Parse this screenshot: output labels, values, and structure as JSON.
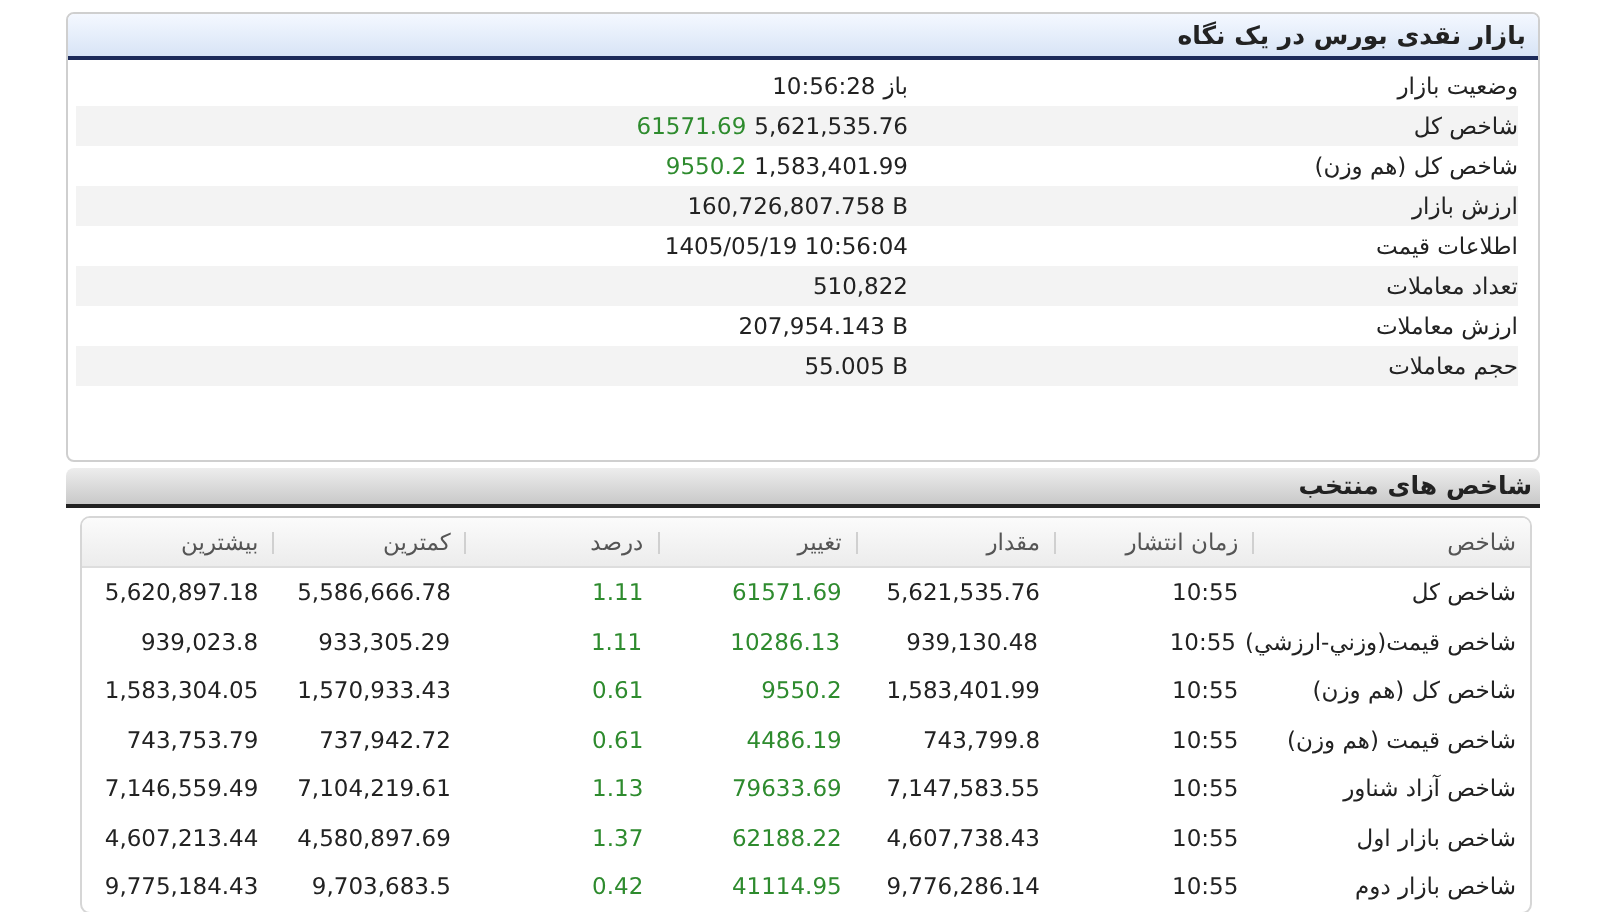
{
  "summary": {
    "title": "بازار نقدی بورس در یک نگاه",
    "rows": [
      {
        "label": "وضعیت بازار",
        "value": "باز",
        "extra": "10:56:28"
      },
      {
        "label": "شاخص کل",
        "value": "5,621,535.76",
        "change": "61571.69"
      },
      {
        "label": "شاخص کل (هم وزن)",
        "value": "1,583,401.99",
        "change": "9550.2"
      },
      {
        "label": "ارزش بازار",
        "value": "160,726,807.758 B"
      },
      {
        "label": "اطلاعات قیمت",
        "value": "1405/05/19 10:56:04"
      },
      {
        "label": "تعداد معاملات",
        "value": "510,822"
      },
      {
        "label": "ارزش معاملات",
        "value": "207,954.143 B"
      },
      {
        "label": "حجم معاملات",
        "value": "55.005 B"
      }
    ]
  },
  "indices": {
    "title": "شاخص های منتخب",
    "columns": [
      "شاخص",
      "زمان انتشار",
      "مقدار",
      "تغییر",
      "درصد",
      "کمترین",
      "بیشترین"
    ],
    "rows": [
      [
        "شاخص کل",
        "10:55",
        "5,621,535.76",
        "61571.69",
        "1.11",
        "5,586,666.78",
        "5,620,897.18"
      ],
      [
        "شاخص قیمت(وزني-ارزشي)",
        "10:55",
        "939,130.48",
        "10286.13",
        "1.11",
        "933,305.29",
        "939,023.8"
      ],
      [
        "شاخص کل (هم وزن)",
        "10:55",
        "1,583,401.99",
        "9550.2",
        "0.61",
        "1,570,933.43",
        "1,583,304.05"
      ],
      [
        "شاخص قیمت (هم وزن)",
        "10:55",
        "743,799.8",
        "4486.19",
        "0.61",
        "737,942.72",
        "743,753.79"
      ],
      [
        "شاخص آزاد شناور",
        "10:55",
        "7,147,583.55",
        "79633.69",
        "1.13",
        "7,104,219.61",
        "7,146,559.49"
      ],
      [
        "شاخص بازار اول",
        "10:55",
        "4,607,738.43",
        "62188.22",
        "1.37",
        "4,580,897.69",
        "4,607,213.44"
      ],
      [
        "شاخص بازار دوم",
        "10:55",
        "9,776,286.14",
        "41114.95",
        "0.42",
        "9,703,683.5",
        "9,775,184.43"
      ]
    ]
  }
}
